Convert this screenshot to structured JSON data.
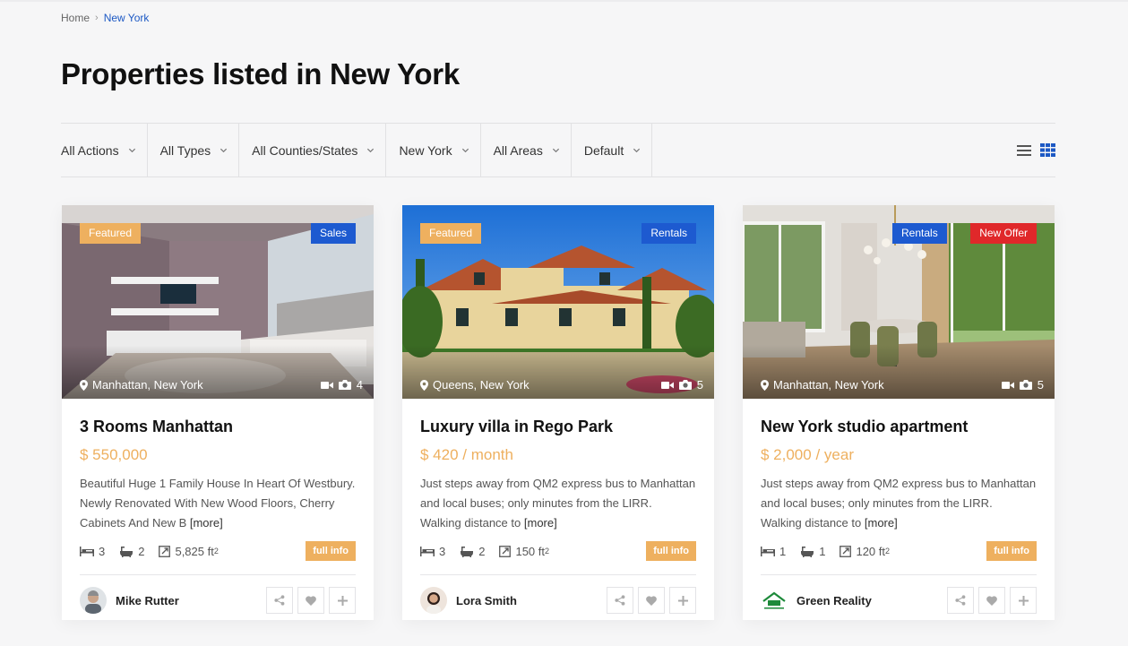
{
  "breadcrumb": {
    "home": "Home",
    "current": "New York"
  },
  "page_title": "Properties listed in New York",
  "filters": [
    "All Actions",
    "All Types",
    "All Counties/States",
    "New York",
    "All Areas",
    "Default"
  ],
  "colors": {
    "accent": "#eeb05f",
    "blue": "#1d5ad0",
    "red": "#e0282a"
  },
  "cards": [
    {
      "badges": {
        "featured": "Featured",
        "status": "Sales"
      },
      "location": "Manhattan, New York",
      "photo_count": "4",
      "title": "3 Rooms Manhattan",
      "price": "$ 550,000",
      "price_period": "",
      "description": "Beautiful Huge 1 Family House In Heart Of Westbury. Newly Renovated With New Wood Floors, Cherry Cabinets And New B",
      "more": "[more]",
      "beds": "3",
      "baths": "2",
      "area": "5,825 ft",
      "full_info": "full info",
      "agent": "Mike Rutter"
    },
    {
      "badges": {
        "featured": "Featured",
        "status": "Rentals"
      },
      "location": "Queens, New York",
      "photo_count": "5",
      "title": "Luxury villa in Rego Park",
      "price": "$ 420",
      "price_period": " / month",
      "description": "Just steps away from QM2 express bus to Manhattan and local buses; only minutes from the LIRR. Walking distance to",
      "more": "[more]",
      "beds": "3",
      "baths": "2",
      "area": "150 ft",
      "full_info": "full info",
      "agent": "Lora Smith"
    },
    {
      "badges": {
        "status": "Rentals",
        "offer": "New Offer"
      },
      "location": "Manhattan, New York",
      "photo_count": "5",
      "title": "New York studio apartment",
      "price": "$ 2,000",
      "price_period": " / year",
      "description": "Just steps away from QM2 express bus to Manhattan and local buses; only minutes from the LIRR. Walking distance to",
      "more": "[more]",
      "beds": "1",
      "baths": "1",
      "area": "120 ft",
      "full_info": "full info",
      "agent": "Green Reality"
    }
  ]
}
